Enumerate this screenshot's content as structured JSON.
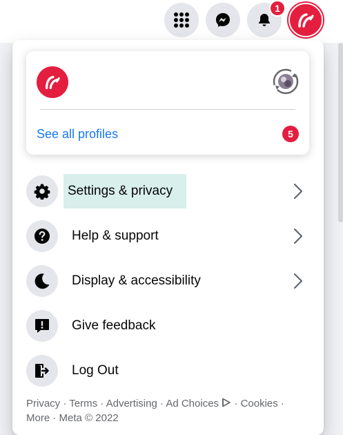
{
  "topbar": {
    "icons": [
      "menu-grid-icon",
      "messenger-icon",
      "notifications-bell-icon",
      "account-avatar"
    ],
    "notification_count": "1"
  },
  "profile_card": {
    "see_all_label": "See all profiles",
    "profiles_count": "5"
  },
  "menu": {
    "items": [
      {
        "label": "Settings & privacy",
        "icon": "gear-icon",
        "has_chevron": true
      },
      {
        "label": "Help & support",
        "icon": "question-icon",
        "has_chevron": true
      },
      {
        "label": "Display & accessibility",
        "icon": "moon-icon",
        "has_chevron": true
      },
      {
        "label": "Give feedback",
        "icon": "feedback-icon",
        "has_chevron": false
      },
      {
        "label": "Log Out",
        "icon": "logout-icon",
        "has_chevron": false
      }
    ]
  },
  "footer": {
    "links": [
      "Privacy",
      "Terms",
      "Advertising",
      "Ad Choices",
      "Cookies",
      "More"
    ],
    "copyright": "Meta © 2022"
  },
  "colors": {
    "accent_red": "#e41e3f",
    "link_blue": "#1877f2",
    "highlight": "#d8efeb"
  }
}
